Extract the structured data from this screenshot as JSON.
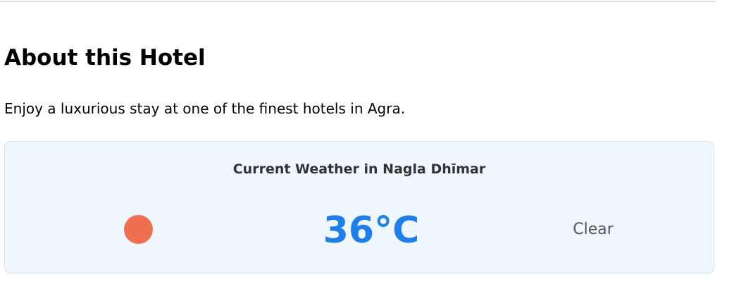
{
  "about": {
    "title": "About this Hotel",
    "description": "Enjoy a luxurious stay at one of the finest hotels in Agra."
  },
  "weather": {
    "heading": "Current Weather in Nagla Dhīmar",
    "icon": "sun-icon",
    "icon_color": "#ef7050",
    "temperature": "36°C",
    "temperature_color": "#1e7fe8",
    "condition": "Clear",
    "card_background": "#eff6fd"
  }
}
